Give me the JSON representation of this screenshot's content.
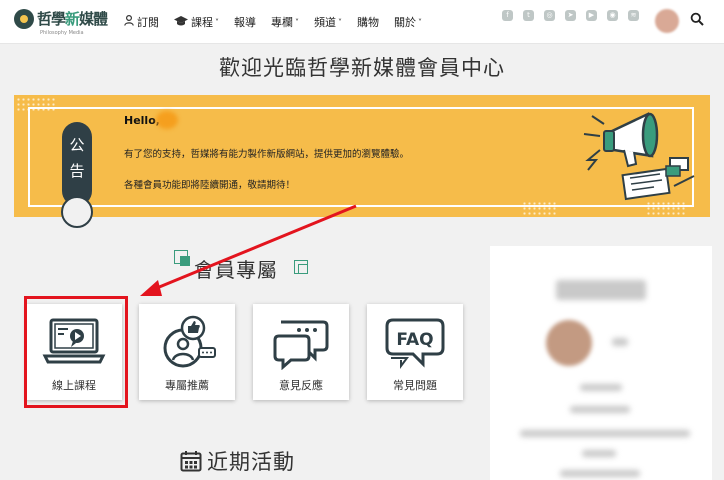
{
  "nav": {
    "logo": {
      "text_a": "哲學",
      "text_b": "新",
      "text_c": "媒體",
      "sub": "Philosophy Media"
    },
    "menu": [
      {
        "label": "訂閱",
        "icon": "user-icon",
        "caret": false
      },
      {
        "label": "課程",
        "icon": "graduation-cap-icon",
        "caret": true
      },
      {
        "label": "報導",
        "icon": "",
        "caret": false
      },
      {
        "label": "專欄",
        "icon": "",
        "caret": true
      },
      {
        "label": "頻道",
        "icon": "",
        "caret": true
      },
      {
        "label": "購物",
        "icon": "",
        "caret": false
      },
      {
        "label": "關於",
        "icon": "",
        "caret": true
      }
    ],
    "social_icons": [
      "facebook-icon",
      "twitter-icon",
      "instagram-icon",
      "telegram-icon",
      "youtube-icon",
      "podcast-icon",
      "rss-icon"
    ],
    "caret_glyph": "˅"
  },
  "page_title": "歡迎光臨哲學新媒體會員中心",
  "banner": {
    "tag": "公告",
    "hello": "Hello,",
    "line1": "有了您的支持，哲媒將有能力製作新版網站，提供更加的瀏覽體驗。",
    "line2": "各種會員功能即將陸續開通，敬請期待！",
    "color": "#f6bc4a"
  },
  "member_section": {
    "title": "會員專屬",
    "cards": [
      {
        "label": "線上課程",
        "icon": "laptop-play-icon"
      },
      {
        "label": "專屬推薦",
        "icon": "thumbs-up-person-icon"
      },
      {
        "label": "意見反應",
        "icon": "chat-bubbles-icon"
      },
      {
        "label": "常見問題",
        "icon": "faq-bubble-icon"
      }
    ],
    "highlight_color": "#e3141e"
  },
  "events_title": "近期活動",
  "side_panel": {
    "title": "會員資訊"
  },
  "accent": "#3a9c7d",
  "dark": "#2f3f46"
}
